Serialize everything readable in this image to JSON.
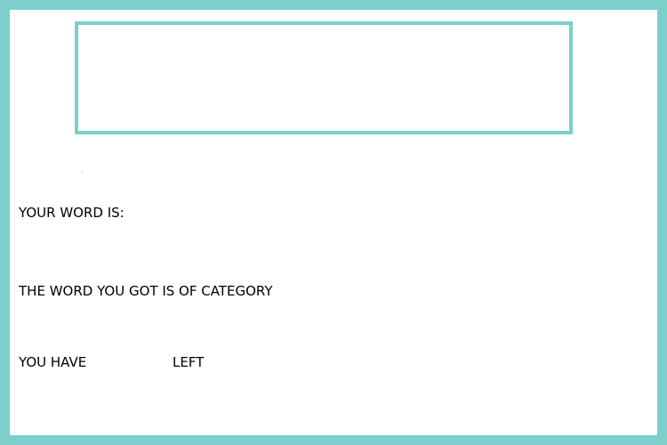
{
  "game": {
    "word_label": "YOUR WORD IS:",
    "category_label": "THE WORD YOU GOT IS OF CATEGORY",
    "attempts_prefix": "YOU HAVE",
    "attempts_suffix": "LEFT"
  },
  "colors": {
    "frame": "#7ccfcb",
    "background": "#ffffff",
    "text": "#000000"
  }
}
